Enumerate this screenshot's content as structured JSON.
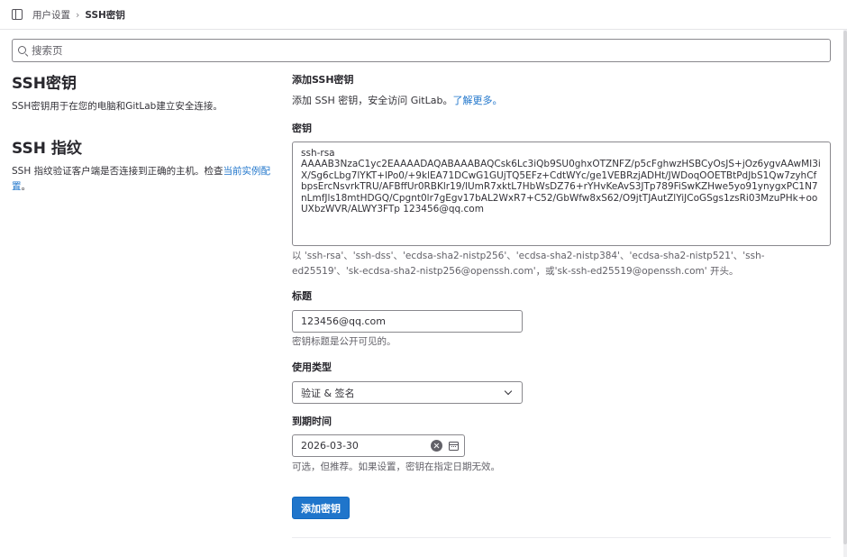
{
  "breadcrumb": {
    "parent": "用户设置",
    "current": "SSH密钥"
  },
  "search": {
    "placeholder": "搜索页"
  },
  "left": {
    "ssh_keys_title": "SSH密钥",
    "ssh_keys_desc": "SSH密钥用于在您的电脑和GitLab建立安全连接。",
    "fingerprint_title": "SSH 指纹",
    "fingerprint_desc": "SSH 指纹验证客户端是否连接到正确的主机。检查",
    "fingerprint_link": "当前实例配置",
    "fingerprint_end": "。"
  },
  "form": {
    "heading": "添加SSH密钥",
    "subtitle": "添加 SSH 密钥，安全访问 GitLab。",
    "learn_more": "了解更多。",
    "key_label": "密钥",
    "key_value": "ssh-rsa\nAAAAB3NzaC1yc2EAAAADAQABAAABAQCsk6Lc3iQb9SU0ghxOTZNFZ/p5cFghwzHSBCyOsJS+jOz6ygvAAwMI3iX/Sg6cLbg7lYKT+lPo0/+9klEA71DCwG1GUjTQ5EFz+CdtWYc/ge1VEBRzjADHt/JWDoqOOETBtPdJbS1Qw7zyhCfbpsErcNsvrkTRU/AFBffUr0RBKlr19/lUmR7xktL7HbWsDZ76+rYHvKeAvS3JTp789FiSwKZHwe5yo91ynygxPC1N7nLmfJls18mtHDGQ/Cpgnt0lr7gEgv17bAL2WxR7+C52/GbWfw8xS62/O9jtTJAutZlYiJCoGSgs1zsRi03MzuPHk+ooUXbzWVR/ALWY3FTp 123456@qq.com",
    "key_help": "以 'ssh-rsa'、'ssh-dss'、'ecdsa-sha2-nistp256'、'ecdsa-sha2-nistp384'、'ecdsa-sha2-nistp521'、'ssh-ed25519'、'sk-ecdsa-sha2-nistp256@openssh.com'，或'sk-ssh-ed25519@openssh.com' 开头。",
    "title_label": "标题",
    "title_value": "123456@qq.com",
    "title_help": "密钥标题是公开可见的。",
    "usage_label": "使用类型",
    "usage_value": "验证 & 签名",
    "expiry_label": "到期时间",
    "expiry_value": "2026-03-30",
    "expiry_help": "可选，但推荐。如果设置，密钥在指定日期无效。",
    "submit_label": "添加密钥"
  },
  "colors": {
    "link": "#1f75cb",
    "primary_button": "#1f75cb"
  }
}
